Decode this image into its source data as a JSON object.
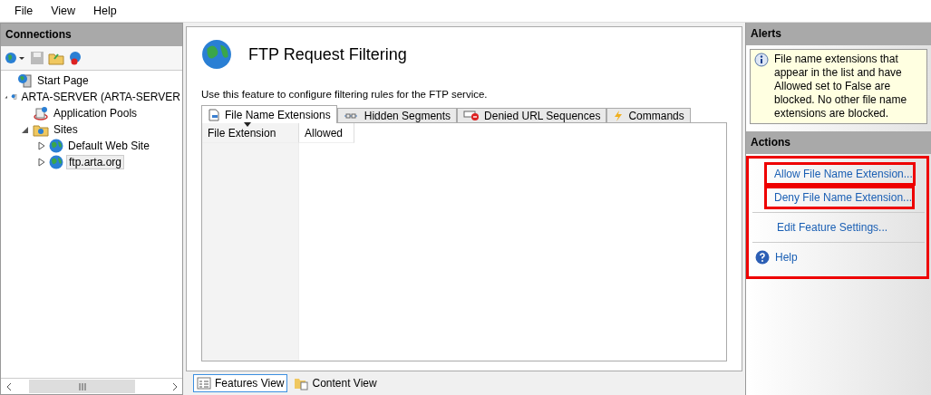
{
  "menu": [
    "File",
    "View",
    "Help"
  ],
  "connections": {
    "title": "Connections",
    "tree": [
      {
        "label": "Start Page",
        "kind": "start",
        "selected": false
      },
      {
        "label": "ARTA-SERVER (ARTA-SERVER",
        "kind": "server",
        "selected": false,
        "expanded": true,
        "children": [
          {
            "label": "Application Pools",
            "kind": "pools",
            "selected": false
          },
          {
            "label": "Sites",
            "kind": "folder",
            "selected": false,
            "expanded": true,
            "children": [
              {
                "label": "Default Web Site",
                "kind": "site",
                "selected": false,
                "expanded": false
              },
              {
                "label": "ftp.arta.org",
                "kind": "site",
                "selected": true,
                "expanded": false
              }
            ]
          }
        ]
      }
    ]
  },
  "feature": {
    "title": "FTP Request Filtering",
    "description": "Use this feature to configure filtering rules for the FTP service.",
    "tabs": [
      {
        "label": "File Name Extensions",
        "selected": true
      },
      {
        "label": "Hidden Segments",
        "selected": false
      },
      {
        "label": "Denied URL Sequences",
        "selected": false
      },
      {
        "label": "Commands",
        "selected": false
      }
    ],
    "columns": [
      {
        "label": "File Extension",
        "sorted": true
      },
      {
        "label": "Allowed",
        "sorted": false
      }
    ]
  },
  "views": [
    {
      "label": "Features View",
      "selected": true
    },
    {
      "label": "Content View",
      "selected": false
    }
  ],
  "alerts": {
    "title": "Alerts",
    "message": "File name extensions that appear in the list and have Allowed set to False are blocked. No other file name extensions are blocked."
  },
  "actions": {
    "title": "Actions",
    "highlighted": true,
    "items": [
      {
        "label": "Allow File Name Extension...",
        "kind": "link",
        "highlighted": true
      },
      {
        "label": "Deny File Name Extension...",
        "kind": "link",
        "highlighted": true
      },
      {
        "label": "Edit Feature Settings...",
        "kind": "link",
        "highlighted": false
      },
      {
        "label": "Help",
        "kind": "help",
        "highlighted": false
      }
    ]
  }
}
